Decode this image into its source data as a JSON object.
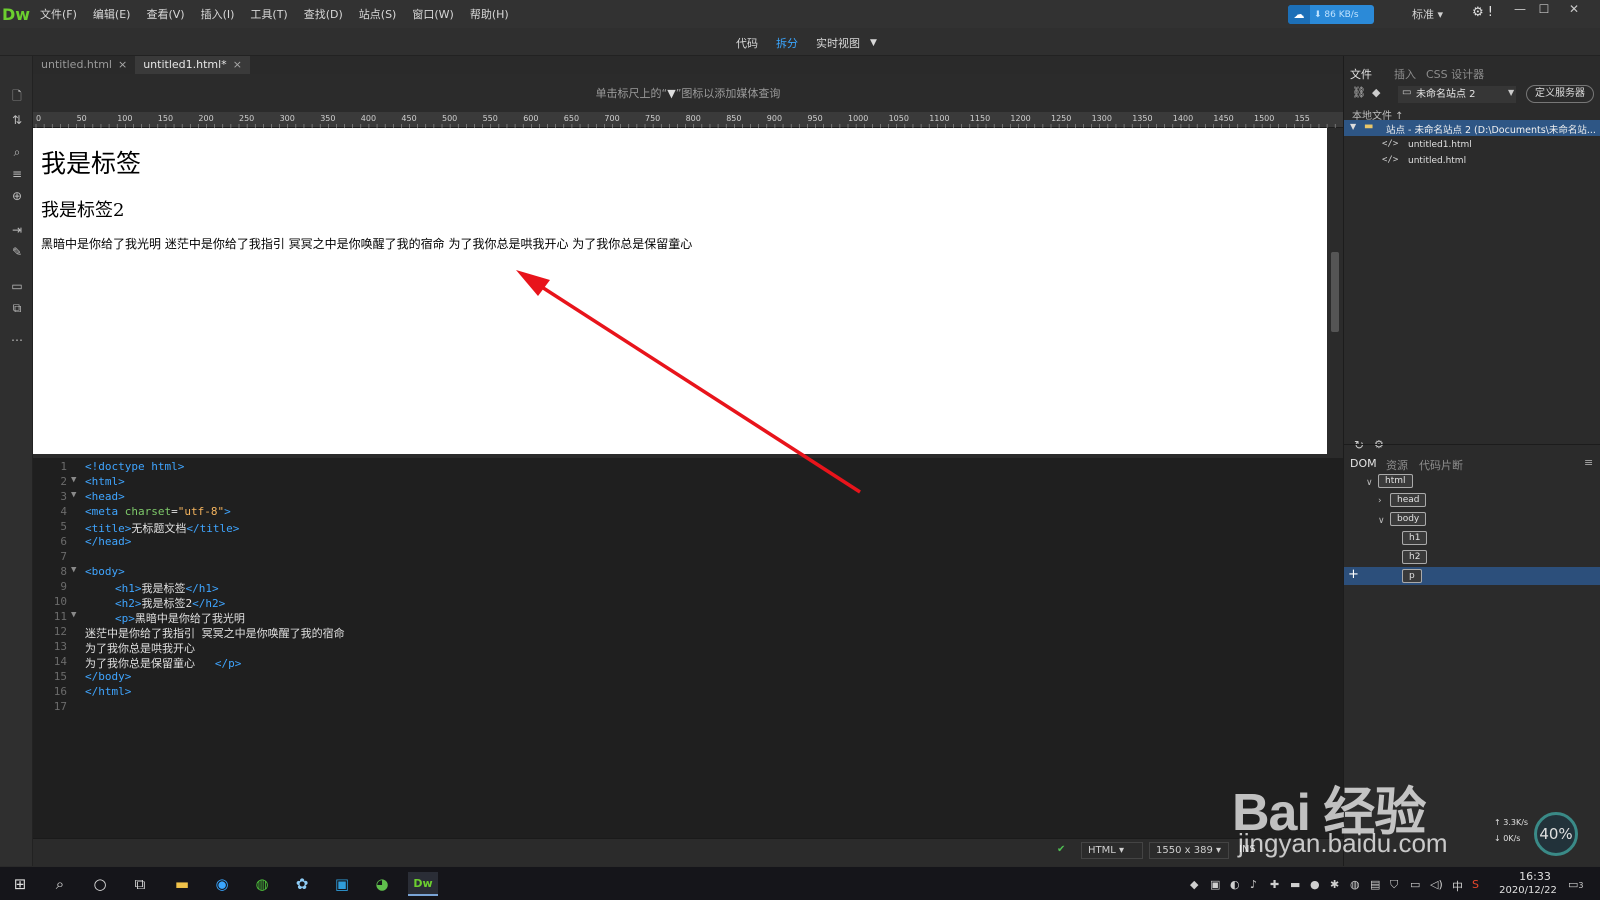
{
  "app": {
    "logo": "Dw",
    "menu": [
      "文件(F)",
      "编辑(E)",
      "查看(V)",
      "插入(I)",
      "工具(T)",
      "查找(D)",
      "站点(S)",
      "窗口(W)",
      "帮助(H)"
    ],
    "cloud_speed": "86 KB/s",
    "workspace": "标准"
  },
  "view_modes": {
    "code": "代码",
    "split": "拆分",
    "live": "实时视图"
  },
  "tabs": [
    {
      "label": "untitled.html",
      "close": "×"
    },
    {
      "label": "untitled1.html*",
      "close": "×"
    }
  ],
  "design": {
    "mq_hint_before": "单击标尺上的“",
    "mq_hint_after": "”图标以添加媒体查询",
    "ruler_labels": [
      "0",
      "50",
      "100",
      "150",
      "200",
      "250",
      "300",
      "350",
      "400",
      "450",
      "500",
      "550",
      "600",
      "650",
      "700",
      "750",
      "800",
      "850",
      "900",
      "950",
      "1000",
      "1050",
      "1100",
      "1150",
      "1200",
      "1250",
      "1300",
      "1350",
      "1400",
      "1450",
      "1500",
      "155"
    ],
    "h1": "我是标签",
    "h2": "我是标签2",
    "p": "黑暗中是你给了我光明 迷茫中是你给了我指引 冥冥之中是你唤醒了我的宿命 为了我你总是哄我开心 为了我你总是保留童心"
  },
  "code": {
    "lines": [
      {
        "n": "1",
        "fold": "",
        "indent": 0,
        "parts": [
          [
            "tag",
            "<!doctype html>"
          ]
        ]
      },
      {
        "n": "2",
        "fold": "▼",
        "indent": 0,
        "parts": [
          [
            "tag",
            "<html>"
          ]
        ]
      },
      {
        "n": "3",
        "fold": "▼",
        "indent": 0,
        "parts": [
          [
            "tag",
            "<head>"
          ]
        ]
      },
      {
        "n": "4",
        "fold": "",
        "indent": 0,
        "parts": [
          [
            "tag",
            "<meta "
          ],
          [
            "attr",
            "charset"
          ],
          [
            "plain",
            "="
          ],
          [
            "val",
            "\"utf-8\""
          ],
          [
            "tag",
            ">"
          ]
        ]
      },
      {
        "n": "5",
        "fold": "",
        "indent": 0,
        "parts": [
          [
            "tag",
            "<title>"
          ],
          [
            "plain",
            "无标题文档"
          ],
          [
            "tag",
            "</title>"
          ]
        ]
      },
      {
        "n": "6",
        "fold": "",
        "indent": 0,
        "parts": [
          [
            "tag",
            "</head>"
          ]
        ]
      },
      {
        "n": "7",
        "fold": "",
        "indent": 0,
        "parts": []
      },
      {
        "n": "8",
        "fold": "▼",
        "indent": 0,
        "parts": [
          [
            "tag",
            "<body>"
          ]
        ]
      },
      {
        "n": "9",
        "fold": "",
        "indent": 1,
        "parts": [
          [
            "tag",
            "<h1>"
          ],
          [
            "plain",
            "我是标签"
          ],
          [
            "tag",
            "</h1>"
          ]
        ]
      },
      {
        "n": "10",
        "fold": "",
        "indent": 1,
        "parts": [
          [
            "tag",
            "<h2>"
          ],
          [
            "plain",
            "我是标签2"
          ],
          [
            "tag",
            "</h2>"
          ]
        ]
      },
      {
        "n": "11",
        "fold": "▼",
        "indent": 1,
        "parts": [
          [
            "tag",
            "<p>"
          ],
          [
            "plain",
            "黑暗中是你给了我光明"
          ]
        ]
      },
      {
        "n": "12",
        "fold": "",
        "indent": 0,
        "parts": [
          [
            "plain",
            "迷茫中是你给了我指引 冥冥之中是你唤醒了我的宿命"
          ]
        ]
      },
      {
        "n": "13",
        "fold": "",
        "indent": 0,
        "parts": [
          [
            "plain",
            "为了我你总是哄我开心"
          ]
        ]
      },
      {
        "n": "14",
        "fold": "",
        "indent": 0,
        "parts": [
          [
            "plain",
            "为了我你总是保留童心   "
          ],
          [
            "tag",
            "</p>"
          ]
        ]
      },
      {
        "n": "15",
        "fold": "",
        "indent": 0,
        "parts": [
          [
            "tag",
            "</body>"
          ]
        ]
      },
      {
        "n": "16",
        "fold": "",
        "indent": 0,
        "parts": [
          [
            "tag",
            "</html>"
          ]
        ]
      },
      {
        "n": "17",
        "fold": "",
        "indent": 0,
        "parts": []
      }
    ]
  },
  "status": {
    "language": "HTML",
    "size": "1550 x 389",
    "mode": "INS"
  },
  "panels": {
    "top_tabs": [
      "文件",
      "插入",
      "CSS 设计器"
    ],
    "site_name": "未命名站点 2",
    "define_server": "定义服务器",
    "local_files": "本地文件",
    "site_root": "站点 - 未命名站点 2 (D:\\Documents\\未命名站...",
    "files": [
      "untitled1.html",
      "untitled.html"
    ],
    "bottom_tabs": [
      "DOM",
      "资源",
      "代码片断"
    ],
    "dom": {
      "html": "html",
      "head": "head",
      "body": "body",
      "h1": "h1",
      "h2": "h2",
      "p": "p"
    }
  },
  "watermark": {
    "brand": "Bai  经验",
    "url": "jingyan.baidu.com"
  },
  "net": {
    "percent": "40%",
    "up": "3.3K/s",
    "down": "0K/s"
  },
  "taskbar": {
    "ime": "中",
    "time": "16:33",
    "date": "2020/12/22",
    "notifications": "3"
  },
  "colors": {
    "accent": "#3aa6ff",
    "arrow": "#e8141b",
    "selection": "#2e5685"
  }
}
